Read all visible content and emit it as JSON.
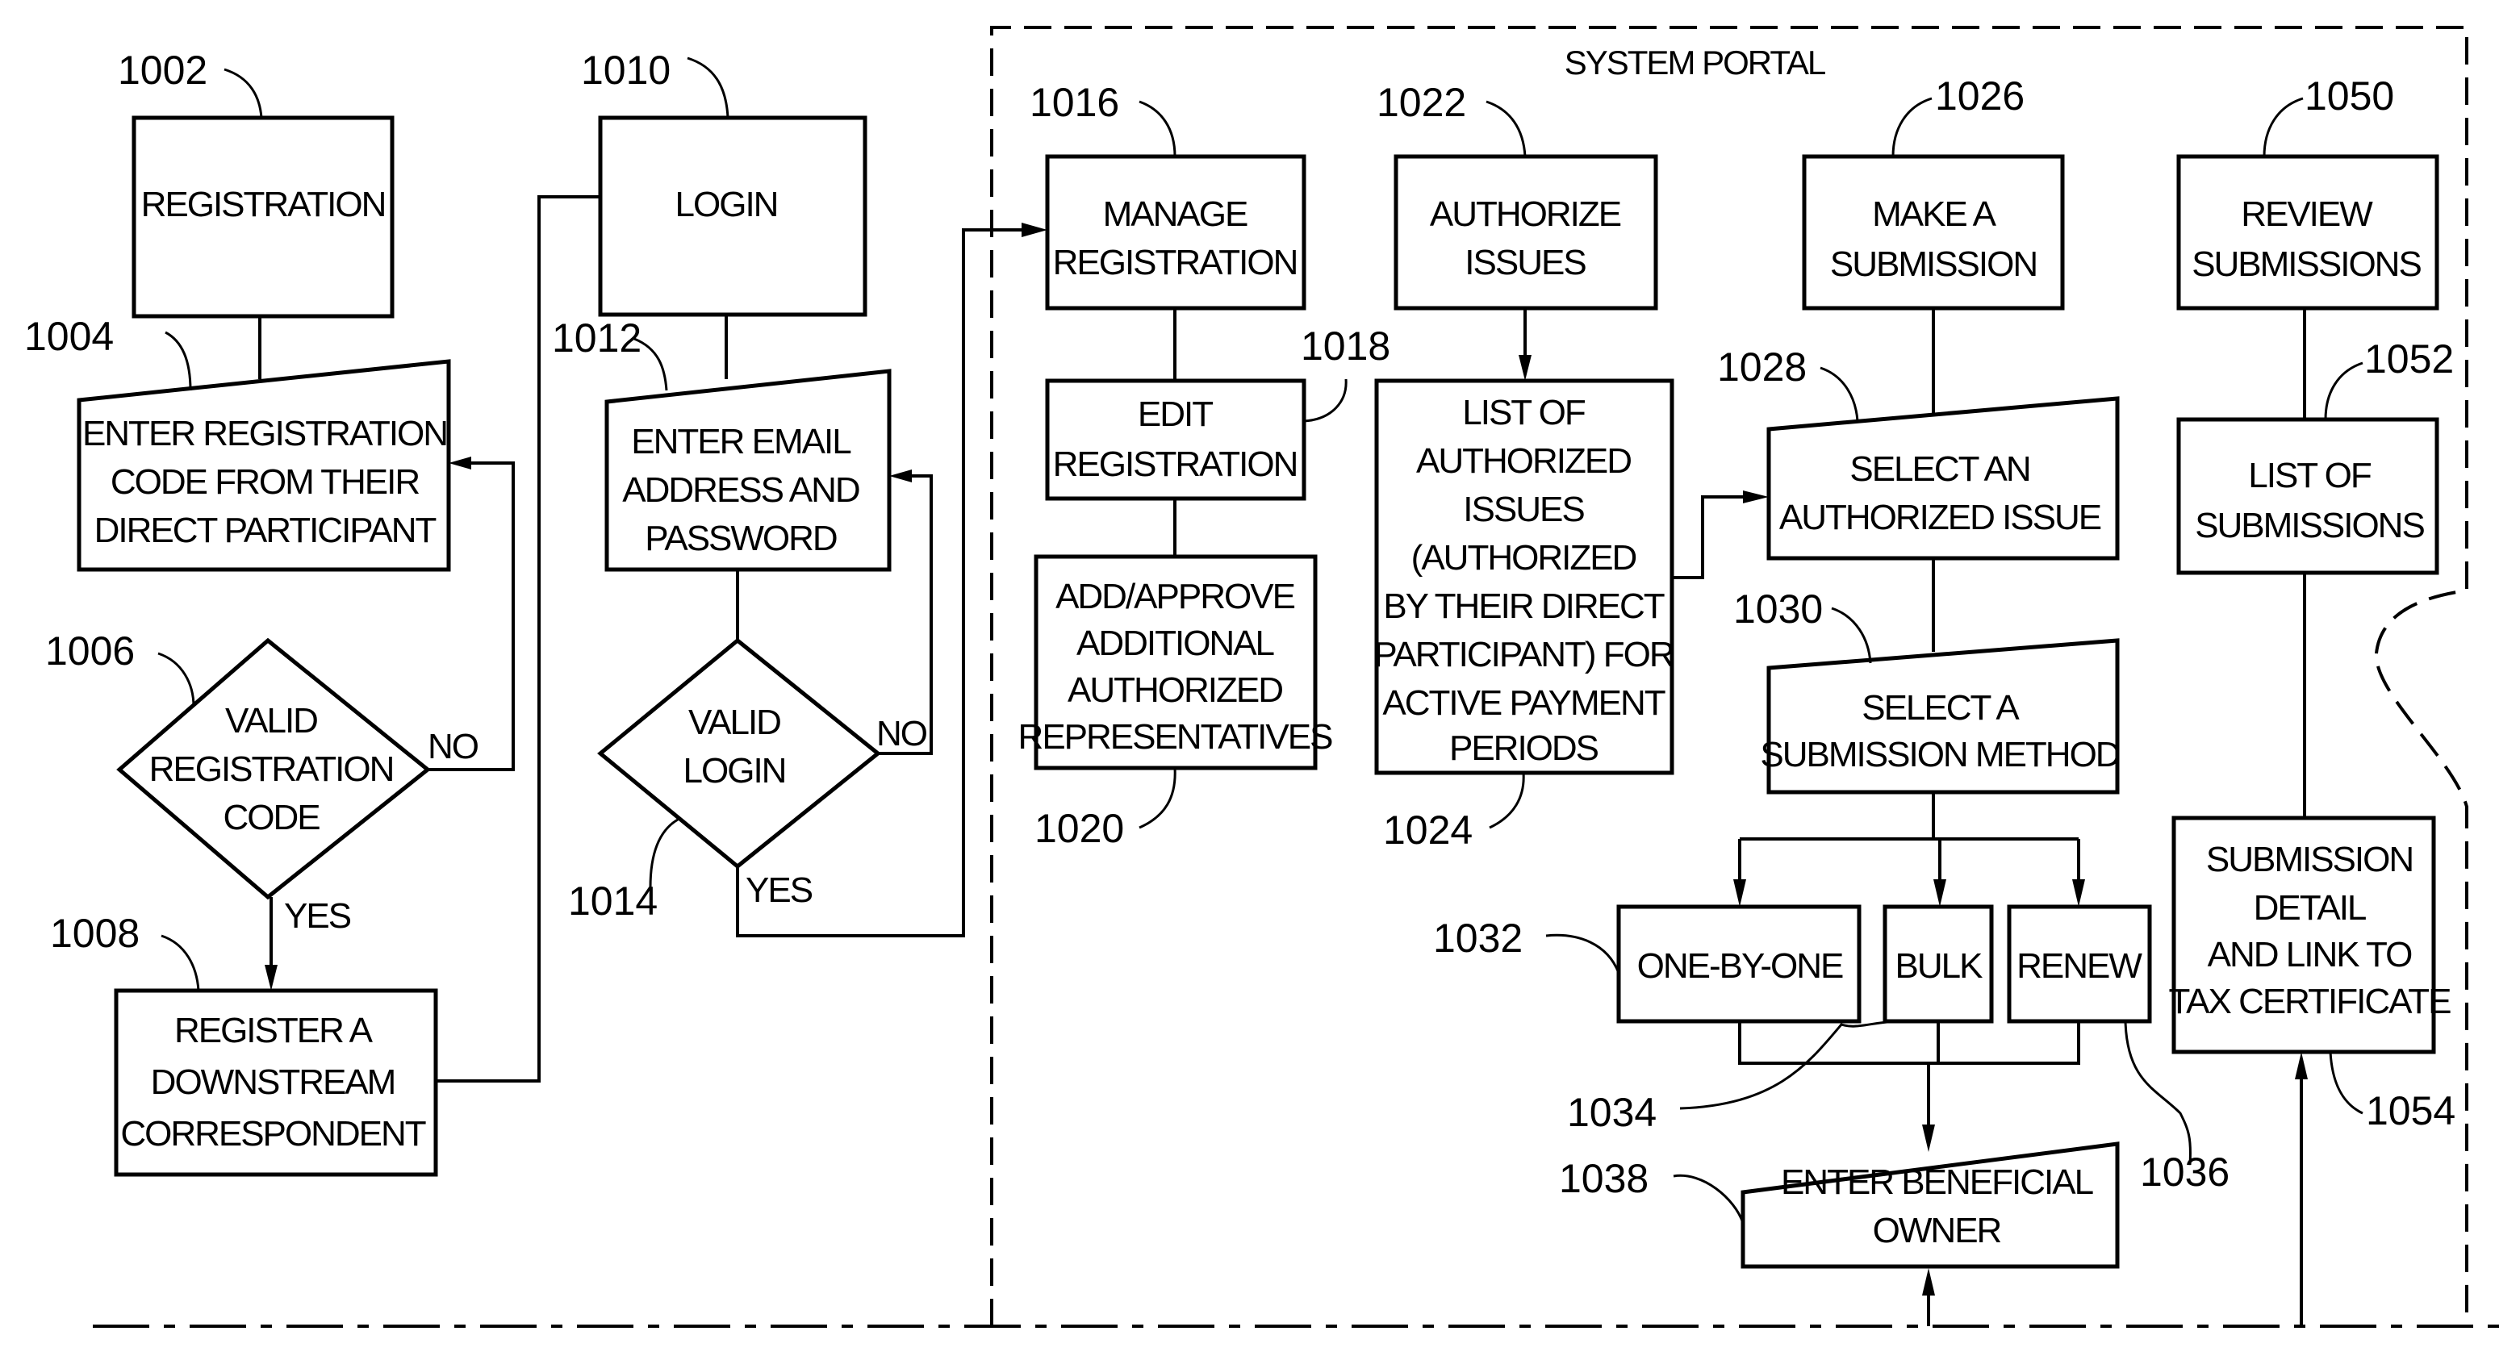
{
  "portal": {
    "title": "SYSTEM PORTAL"
  },
  "nodes": {
    "n1002": {
      "ref": "1002",
      "lines": [
        "REGISTRATION"
      ]
    },
    "n1004": {
      "ref": "1004",
      "lines": [
        "ENTER REGISTRATION",
        "CODE FROM THEIR",
        "DIRECT PARTICIPANT"
      ]
    },
    "n1006": {
      "ref": "1006",
      "lines": [
        "VALID",
        "REGISTRATION",
        "CODE"
      ]
    },
    "n1008": {
      "ref": "1008",
      "lines": [
        "REGISTER A",
        "DOWNSTREAM",
        "CORRESPONDENT"
      ]
    },
    "n1010": {
      "ref": "1010",
      "lines": [
        "LOGIN"
      ]
    },
    "n1012": {
      "ref": "1012",
      "lines": [
        "ENTER EMAIL",
        "ADDRESS AND",
        "PASSWORD"
      ]
    },
    "n1014": {
      "ref": "1014",
      "lines": [
        "VALID",
        "LOGIN"
      ]
    },
    "n1016": {
      "ref": "1016",
      "lines": [
        "MANAGE",
        "REGISTRATION"
      ]
    },
    "n1018": {
      "ref": "1018",
      "lines": [
        "EDIT",
        "REGISTRATION"
      ]
    },
    "n1020": {
      "ref": "1020",
      "lines": [
        "ADD/APPROVE",
        "ADDITIONAL",
        "AUTHORIZED",
        "REPRESENTATIVES"
      ]
    },
    "n1022": {
      "ref": "1022",
      "lines": [
        "AUTHORIZE",
        "ISSUES"
      ]
    },
    "n1024": {
      "ref": "1024",
      "lines": [
        "LIST OF",
        "AUTHORIZED",
        "ISSUES",
        "(AUTHORIZED",
        "BY THEIR DIRECT",
        "PARTICIPANT) FOR",
        "ACTIVE PAYMENT",
        "PERIODS"
      ]
    },
    "n1026": {
      "ref": "1026",
      "lines": [
        "MAKE A",
        "SUBMISSION"
      ]
    },
    "n1028": {
      "ref": "1028",
      "lines": [
        "SELECT AN",
        "AUTHORIZED ISSUE"
      ]
    },
    "n1030": {
      "ref": "1030",
      "lines": [
        "SELECT A",
        "SUBMISSION METHOD"
      ]
    },
    "n1032": {
      "ref": "1032",
      "lines": [
        "ONE-BY-ONE"
      ]
    },
    "n1034": {
      "ref": "1034",
      "lines": [
        "BULK"
      ]
    },
    "n1036": {
      "ref": "1036",
      "lines": [
        "RENEW"
      ]
    },
    "n1038": {
      "ref": "1038",
      "lines": [
        "ENTER BENEFICIAL",
        "OWNER"
      ]
    },
    "n1050": {
      "ref": "1050",
      "lines": [
        "REVIEW",
        "SUBMISSIONS"
      ]
    },
    "n1052": {
      "ref": "1052",
      "lines": [
        "LIST OF",
        "SUBMISSIONS"
      ]
    },
    "n1054": {
      "ref": "1054",
      "lines": [
        "SUBMISSION",
        "DETAIL",
        "AND LINK TO",
        "TAX CERTIFICATE"
      ]
    }
  },
  "branch_labels": {
    "d1006_no": "NO",
    "d1006_yes": "YES",
    "d1014_no": "NO",
    "d1014_yes": "YES"
  }
}
